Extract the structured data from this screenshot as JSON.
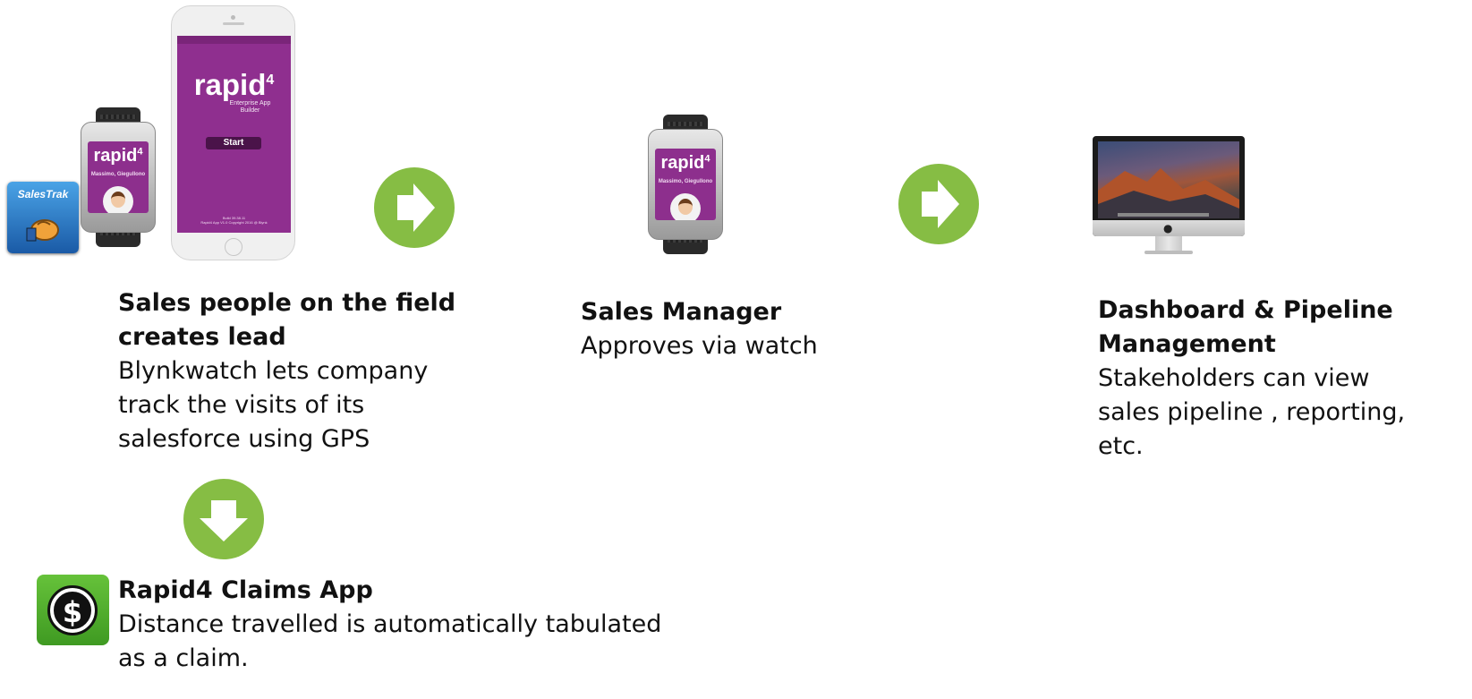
{
  "stage1": {
    "title_line1": "Sales people on the field",
    "title_line2": "creates lead",
    "desc_line1": "Blynkwatch lets company",
    "desc_line2": "track the visits of its",
    "desc_line3": "salesforce using GPS"
  },
  "stage2": {
    "title": "Sales Manager",
    "desc": "Approves via watch"
  },
  "stage3": {
    "title_line1": "Dashboard & Pipeline",
    "title_line2": "Management",
    "desc_line1": "Stakeholders can view",
    "desc_line2": "sales pipeline , reporting,",
    "desc_line3": "etc."
  },
  "stage4": {
    "title": "Rapid4 Claims App",
    "desc_line1": "Distance travelled is automatically tabulated",
    "desc_line2": "as a claim."
  },
  "salestrak_icon": {
    "label": "SalesTrak"
  },
  "watch_screen": {
    "brand": "rapid",
    "brand_sup": "4",
    "user_name": "Massimo, Giegullono"
  },
  "phone_screen": {
    "brand": "rapid",
    "brand_sup": "4",
    "subtitle_line1": "Enterprise App",
    "subtitle_line2": "Builder",
    "start_button": "Start",
    "build_line1": "Build 39.38.11",
    "build_line2": "Rapid4 App V1.0 Copyright 2016 @ Blynk"
  },
  "colors": {
    "arrow_green": "#86bd44",
    "rapid4_purple": "#8f2f8f",
    "claims_green": "#4fae2b"
  },
  "icons": {
    "arrows": [
      "arrow-right-icon",
      "arrow-right-icon",
      "arrow-down-icon"
    ],
    "claims": "dollar-coin-icon"
  }
}
